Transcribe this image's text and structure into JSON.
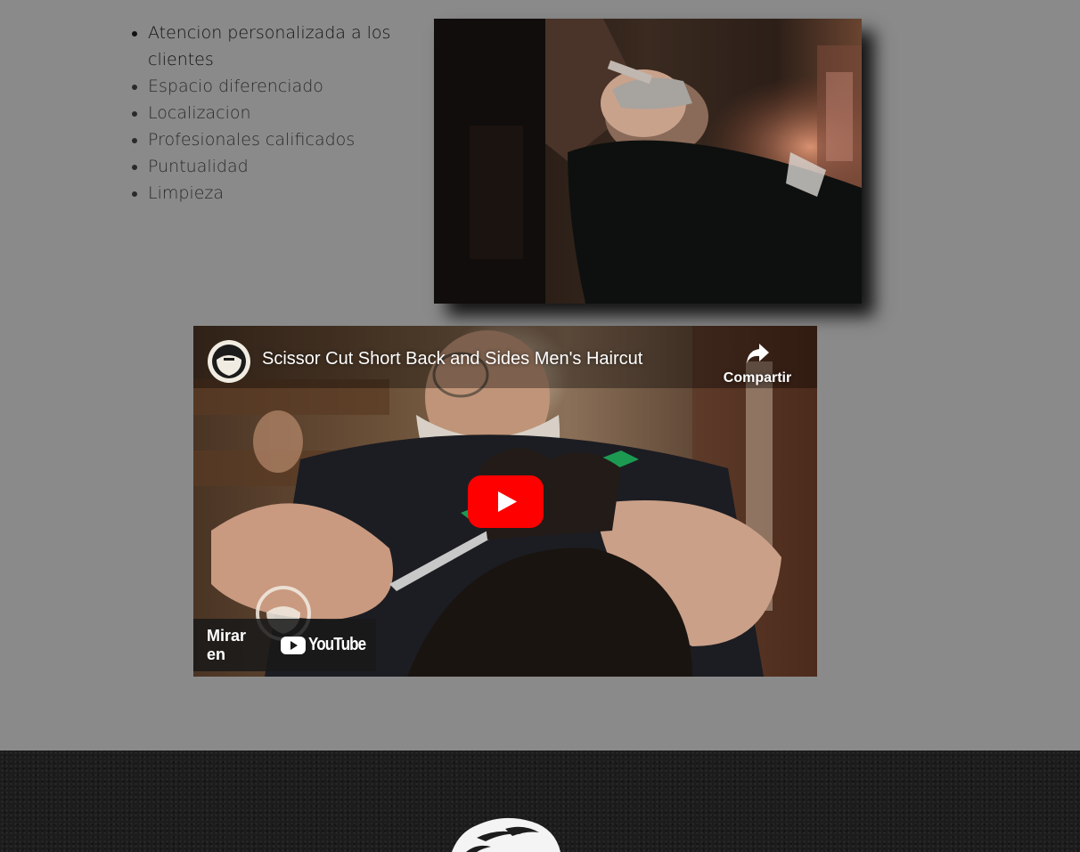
{
  "features": {
    "items": [
      "Atencion personalizada a los clientes",
      "Espacio diferenciado",
      "Localizacion",
      "Profesionales calificados",
      "Puntualidad",
      "Limpieza"
    ]
  },
  "photo": {
    "icon": "barber-shaving-photo"
  },
  "video": {
    "title": "Scissor Cut Short Back and Sides Men's Haircut",
    "share_label": "Compartir",
    "watch_on_label": "Mirar en",
    "youtube_word": "YouTube",
    "colors": {
      "play": "#ff0000",
      "overlay": "#191919"
    }
  },
  "footer": {
    "logo_icon": "barber-logo-icon",
    "background": "#1c1c1c"
  }
}
